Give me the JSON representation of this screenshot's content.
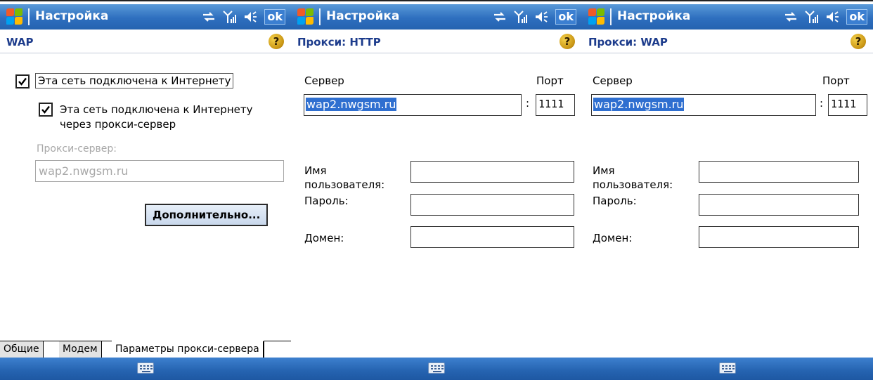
{
  "screens": [
    {
      "title": "Настройка",
      "ok_label": "ok",
      "page_title": "WAP",
      "help_label": "?",
      "internet_checkbox": {
        "label": "Эта сеть подключена к Интернету",
        "checked": true
      },
      "proxy_checkbox": {
        "label_line1": "Эта сеть подключена к Интернету",
        "label_line2": "через прокси-сервер",
        "checked": true
      },
      "proxy_server_label": "Прокси-сервер:",
      "proxy_server_value": "wap2.nwgsm.ru",
      "advanced_button": "Дополнительно...",
      "tabs": [
        {
          "label": "Общие",
          "active": false
        },
        {
          "label": "Модем",
          "active": false
        },
        {
          "label": "Параметры прокси-сервера",
          "active": true
        }
      ]
    },
    {
      "title": "Настройка",
      "ok_label": "ok",
      "page_title": "Прокси: HTTP",
      "help_label": "?",
      "server_label": "Сервер",
      "port_label": "Порт",
      "server_value": "wap2.nwgsm.ru",
      "colon": ":",
      "port_value": "1111",
      "username_label_line1": "Имя",
      "username_label_line2": "пользователя:",
      "username_value": "",
      "password_label": "Пароль:",
      "password_value": "",
      "domain_label": "Домен:",
      "domain_value": ""
    },
    {
      "title": "Настройка",
      "ok_label": "ok",
      "page_title": "Прокси: WAP",
      "help_label": "?",
      "server_label": "Сервер",
      "port_label": "Порт",
      "server_value": "wap2.nwgsm.ru",
      "colon": ":",
      "port_value": "1111",
      "username_label_line1": "Имя",
      "username_label_line2": "пользователя:",
      "username_value": "",
      "password_label": "Пароль:",
      "password_value": "",
      "domain_label": "Домен:",
      "domain_value": ""
    }
  ],
  "colors": {
    "titlebar": "#2e6fbf",
    "selection": "#2f6fd0",
    "page_title": "#1d3c8c"
  }
}
